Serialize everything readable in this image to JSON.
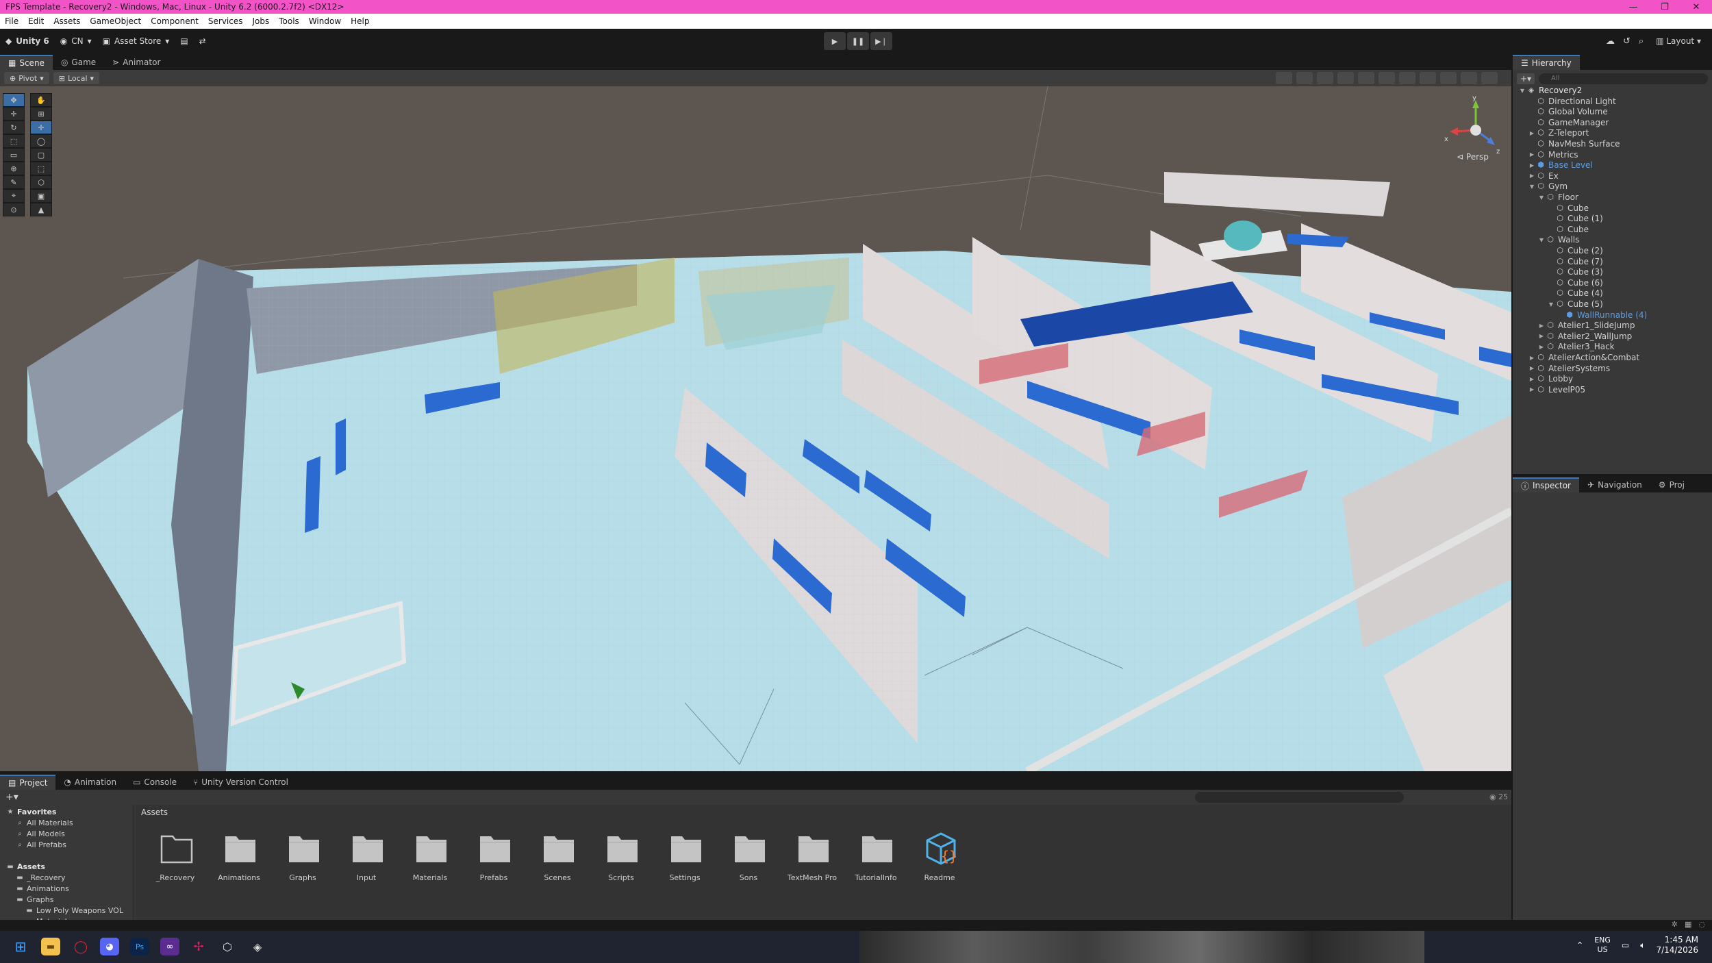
{
  "window": {
    "title": "FPS Template - Recovery2 - Windows, Mac, Linux - Unity 6.2 (6000.2.7f2) <DX12>",
    "controls": [
      "—",
      "❐",
      "✕"
    ]
  },
  "menu": [
    "File",
    "Edit",
    "Assets",
    "GameObject",
    "Component",
    "Services",
    "Jobs",
    "Tools",
    "Window",
    "Help"
  ],
  "toolbar": {
    "unity_label": "Unity 6",
    "account_label": "CN",
    "asset_store_label": "Asset Store",
    "layout_label": "Layout"
  },
  "scene_tabs": [
    "Scene",
    "Game",
    "Animator"
  ],
  "scene_toolbar": {
    "pivot_label": "Pivot",
    "local_label": "Local"
  },
  "viewport": {
    "persp_label": "Persp",
    "gizmo_axes": [
      "y",
      "x",
      "z"
    ]
  },
  "hierarchy": {
    "tab_label": "Hierarchy",
    "search_placeholder": "All",
    "items": [
      {
        "label": "Recovery2",
        "depth": 0,
        "arrow": "▼",
        "icon": "unity-scene-icon",
        "style": "root"
      },
      {
        "label": "Directional Light",
        "depth": 1,
        "arrow": "",
        "icon": "gameobject-icon",
        "style": ""
      },
      {
        "label": "Global Volume",
        "depth": 1,
        "arrow": "",
        "icon": "gameobject-icon",
        "style": ""
      },
      {
        "label": "GameManager",
        "depth": 1,
        "arrow": "",
        "icon": "gameobject-icon",
        "style": ""
      },
      {
        "label": "Z-Teleport",
        "depth": 1,
        "arrow": "▶",
        "icon": "gameobject-icon",
        "style": ""
      },
      {
        "label": "NavMesh Surface",
        "depth": 1,
        "arrow": "",
        "icon": "gameobject-icon",
        "style": ""
      },
      {
        "label": "Metrics",
        "depth": 1,
        "arrow": "▶",
        "icon": "gameobject-icon",
        "style": ""
      },
      {
        "label": "Base Level",
        "depth": 1,
        "arrow": "▶",
        "icon": "prefab-icon",
        "style": "blue"
      },
      {
        "label": "Ex",
        "depth": 1,
        "arrow": "▶",
        "icon": "gameobject-icon",
        "style": ""
      },
      {
        "label": "Gym",
        "depth": 1,
        "arrow": "▼",
        "icon": "gameobject-icon",
        "style": ""
      },
      {
        "label": "Floor",
        "depth": 2,
        "arrow": "▼",
        "icon": "gameobject-icon",
        "style": ""
      },
      {
        "label": "Cube",
        "depth": 3,
        "arrow": "",
        "icon": "gameobject-icon",
        "style": ""
      },
      {
        "label": "Cube (1)",
        "depth": 3,
        "arrow": "",
        "icon": "gameobject-icon",
        "style": ""
      },
      {
        "label": "Cube",
        "depth": 3,
        "arrow": "",
        "icon": "gameobject-icon",
        "style": ""
      },
      {
        "label": "Walls",
        "depth": 2,
        "arrow": "▼",
        "icon": "gameobject-icon",
        "style": ""
      },
      {
        "label": "Cube (2)",
        "depth": 3,
        "arrow": "",
        "icon": "gameobject-icon",
        "style": ""
      },
      {
        "label": "Cube (7)",
        "depth": 3,
        "arrow": "",
        "icon": "gameobject-icon",
        "style": ""
      },
      {
        "label": "Cube (3)",
        "depth": 3,
        "arrow": "",
        "icon": "gameobject-icon",
        "style": ""
      },
      {
        "label": "Cube (6)",
        "depth": 3,
        "arrow": "",
        "icon": "gameobject-icon",
        "style": ""
      },
      {
        "label": "Cube (4)",
        "depth": 3,
        "arrow": "",
        "icon": "gameobject-icon",
        "style": ""
      },
      {
        "label": "Cube (5)",
        "depth": 3,
        "arrow": "▼",
        "icon": "gameobject-icon",
        "style": ""
      },
      {
        "label": "WallRunnable (4)",
        "depth": 4,
        "arrow": "",
        "icon": "prefab-icon",
        "style": "blue"
      },
      {
        "label": "Atelier1_SlideJump",
        "depth": 2,
        "arrow": "▶",
        "icon": "gameobject-icon",
        "style": ""
      },
      {
        "label": "Atelier2_WallJump",
        "depth": 2,
        "arrow": "▶",
        "icon": "gameobject-icon",
        "style": ""
      },
      {
        "label": "Atelier3_Hack",
        "depth": 2,
        "arrow": "▶",
        "icon": "gameobject-icon",
        "style": ""
      },
      {
        "label": "AtelierAction&Combat",
        "depth": 1,
        "arrow": "▶",
        "icon": "gameobject-icon",
        "style": ""
      },
      {
        "label": "AtelierSystems",
        "depth": 1,
        "arrow": "▶",
        "icon": "gameobject-icon",
        "style": ""
      },
      {
        "label": "Lobby",
        "depth": 1,
        "arrow": "▶",
        "icon": "gameobject-icon",
        "style": ""
      },
      {
        "label": "LevelP05",
        "depth": 1,
        "arrow": "▶",
        "icon": "gameobject-icon",
        "style": ""
      }
    ]
  },
  "inspector_tabs": [
    "Inspector",
    "Navigation",
    "Proj"
  ],
  "project_tabs": [
    "Project",
    "Animation",
    "Console",
    "Unity Version Control"
  ],
  "project": {
    "count": "25",
    "breadcrumb": "Assets",
    "tree": [
      {
        "label": "Favorites",
        "depth": 0,
        "icon": "star-icon",
        "header": true
      },
      {
        "label": "All Materials",
        "depth": 1,
        "icon": "search-icon",
        "header": false
      },
      {
        "label": "All Models",
        "depth": 1,
        "icon": "search-icon",
        "header": false
      },
      {
        "label": "All Prefabs",
        "depth": 1,
        "icon": "search-icon",
        "header": false
      },
      {
        "label": "Assets",
        "depth": 0,
        "icon": "folder-icon",
        "header": true
      },
      {
        "label": "_Recovery",
        "depth": 1,
        "icon": "folder-icon",
        "header": false
      },
      {
        "label": "Animations",
        "depth": 1,
        "icon": "folder-icon",
        "header": false
      },
      {
        "label": "Graphs",
        "depth": 1,
        "icon": "folder-icon",
        "header": false
      },
      {
        "label": "Low Poly Weapons VOL",
        "depth": 2,
        "icon": "folder-icon",
        "header": false
      },
      {
        "label": "Materials",
        "depth": 2,
        "icon": "folder-icon",
        "header": false
      }
    ],
    "assets": [
      {
        "label": "_Recovery",
        "kind": "folder-empty"
      },
      {
        "label": "Animations",
        "kind": "folder"
      },
      {
        "label": "Graphs",
        "kind": "folder"
      },
      {
        "label": "Input",
        "kind": "folder"
      },
      {
        "label": "Materials",
        "kind": "folder"
      },
      {
        "label": "Prefabs",
        "kind": "folder"
      },
      {
        "label": "Scenes",
        "kind": "folder"
      },
      {
        "label": "Scripts",
        "kind": "folder"
      },
      {
        "label": "Settings",
        "kind": "folder"
      },
      {
        "label": "Sons",
        "kind": "folder"
      },
      {
        "label": "TextMesh Pro",
        "kind": "folder"
      },
      {
        "label": "TutorialInfo",
        "kind": "folder"
      },
      {
        "label": "Readme",
        "kind": "readme"
      }
    ]
  },
  "taskbar": {
    "icons": [
      "windows-start-icon",
      "file-explorer-icon",
      "opera-icon",
      "discord-icon",
      "photoshop-icon",
      "visual-studio-icon",
      "slack-icon",
      "unity-hub-icon",
      "unity-icon"
    ],
    "lang_line1": "ENG",
    "lang_line2": "US",
    "time": "1:45 AM",
    "date": "7/14/2026"
  },
  "colors": {
    "title_bar": "#f254c7",
    "panel": "#383838",
    "prefab_blue": "#5c9ce6",
    "floor": "#b7dde8",
    "wall_blue": "#2a6ad1"
  }
}
